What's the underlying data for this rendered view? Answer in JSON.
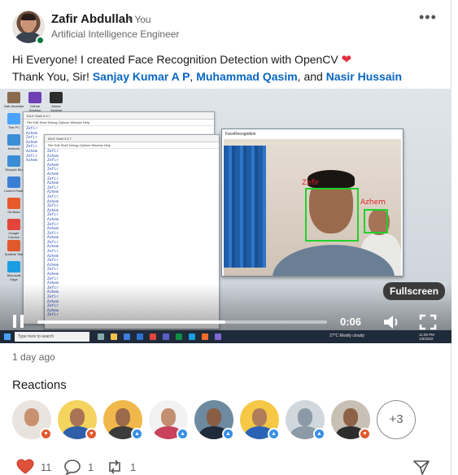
{
  "post": {
    "author_name": "Zafir Abdullah",
    "author_relation": "• You",
    "author_headline": "Artificial Intelligence Engineer",
    "more_icon": "ellipsis-icon",
    "text_line1": "Hi Everyone! I created Face Recognition Detection with OpenCV",
    "text_line2_prefix": "Thank You, Sir! ",
    "mention1": "Sanjay Kumar A P",
    "sep1": ", ",
    "mention2": "Muhammad Qasim",
    "sep2": ", and ",
    "mention3": "Nasir Hussain",
    "age": "1 day ago"
  },
  "video": {
    "fullscreen_tooltip": "Fullscreen",
    "current_time": "0:06",
    "progress_fraction": 0.65,
    "desktop_icons": [
      "Zafir Abdullah",
      "GitHub Desktop",
      "Adobe Acrobat",
      "This PC",
      "Network",
      "Recycle Bin",
      "Control Panel",
      "Git Bash",
      "Google Chrome",
      "Sublime Text",
      "Microsoft Edge"
    ],
    "shell_title_back": "IDLE Shell 3.9.7",
    "shell_title_front": "IDLE Shell 3.9.7",
    "shell_menu": "File  Edit  Shell  Debug  Options  Window  Help",
    "shell_lines": [
      "Zefir",
      "Azhem",
      "Zefir",
      "Azhem",
      "Zefir",
      "Azhem",
      "Zefir",
      "Azhem",
      "Zefir",
      "Azhem",
      "Zefir",
      "Azhem",
      "Zefir",
      "Azhem",
      "Zefir",
      "Azhem",
      "Zefir",
      "Azhem",
      "Zefir",
      "Azhem",
      "Zefir",
      "Azhem",
      "Zefir",
      "Azhem",
      "Zefir",
      "Azhem",
      "Zefir",
      "Azhem",
      "Zefir",
      "Azhem",
      "Zefir",
      "Azhem",
      "Zefir",
      "Azhem",
      "Zefir",
      "Azhem",
      "Zefir"
    ],
    "face_window_title": "FaceRecognition",
    "face_label_1": "Zefir",
    "face_label_2": "Azhem",
    "taskbar_search": "Type here to search",
    "weather": "27°C  Mostly cloudy",
    "clock_time": "11:08 PM",
    "clock_date": "1/5/2022"
  },
  "reactions": {
    "title": "Reactions",
    "more_count": "+3",
    "people": [
      {
        "skin": "#c9916f",
        "shirt": "#e8e2dc",
        "bg": "#e9e4df",
        "badge": "#e05a2c"
      },
      {
        "skin": "#a97455",
        "shirt": "#2f5fa8",
        "bg": "#f4d35e",
        "badge": "#e05a2c"
      },
      {
        "skin": "#9b6a4a",
        "shirt": "#3b3b3b",
        "bg": "#f0b84a",
        "badge": "#378fe9"
      },
      {
        "skin": "#c48e70",
        "shirt": "#c7425a",
        "bg": "#f2f2f2",
        "badge": "#378fe9"
      },
      {
        "skin": "#8a5e44",
        "shirt": "#1f2a3a",
        "bg": "#6d8aa0",
        "badge": "#378fe9"
      },
      {
        "skin": "#b07d5b",
        "shirt": "#2a63b5",
        "bg": "#f6c845",
        "badge": "#378fe9"
      },
      {
        "skin": "#8b9aa6",
        "shirt": "#8b9aa6",
        "bg": "#d0d7dd",
        "badge": "#378fe9"
      },
      {
        "skin": "#8e6247",
        "shirt": "#2d2d2d",
        "bg": "#c8c0b5",
        "badge": "#e05a2c"
      }
    ]
  },
  "social": {
    "like_count": "11",
    "comment_count": "1",
    "repost_count": "1",
    "like_icon": "heart-outline-icon",
    "comment_icon": "comment-icon",
    "repost_icon": "repost-icon",
    "send_icon": "send-icon"
  },
  "colors": {
    "link": "#0a66c2",
    "online": "#057642",
    "love": "#e05a2c",
    "like": "#378fe9"
  }
}
